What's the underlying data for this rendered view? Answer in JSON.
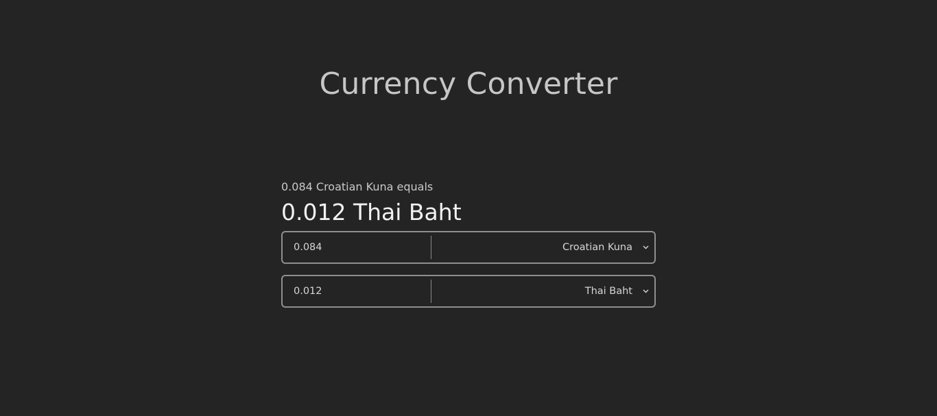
{
  "app": {
    "title": "Currency Converter"
  },
  "summary": {
    "from_text": "0.084 Croatian Kuna equals",
    "result_text": "0.012 Thai Baht"
  },
  "from_row": {
    "amount_value": "0.084",
    "currency_selected": "Croatian Kuna",
    "chevron_icon": "chevron-down-icon"
  },
  "to_row": {
    "amount_value": "0.012",
    "currency_selected": "Thai Baht",
    "chevron_icon": "chevron-down-icon"
  },
  "colors": {
    "background": "#242424",
    "title": "#c6c6c6",
    "result": "#f2f2f2",
    "border": "#8f8f8f"
  }
}
